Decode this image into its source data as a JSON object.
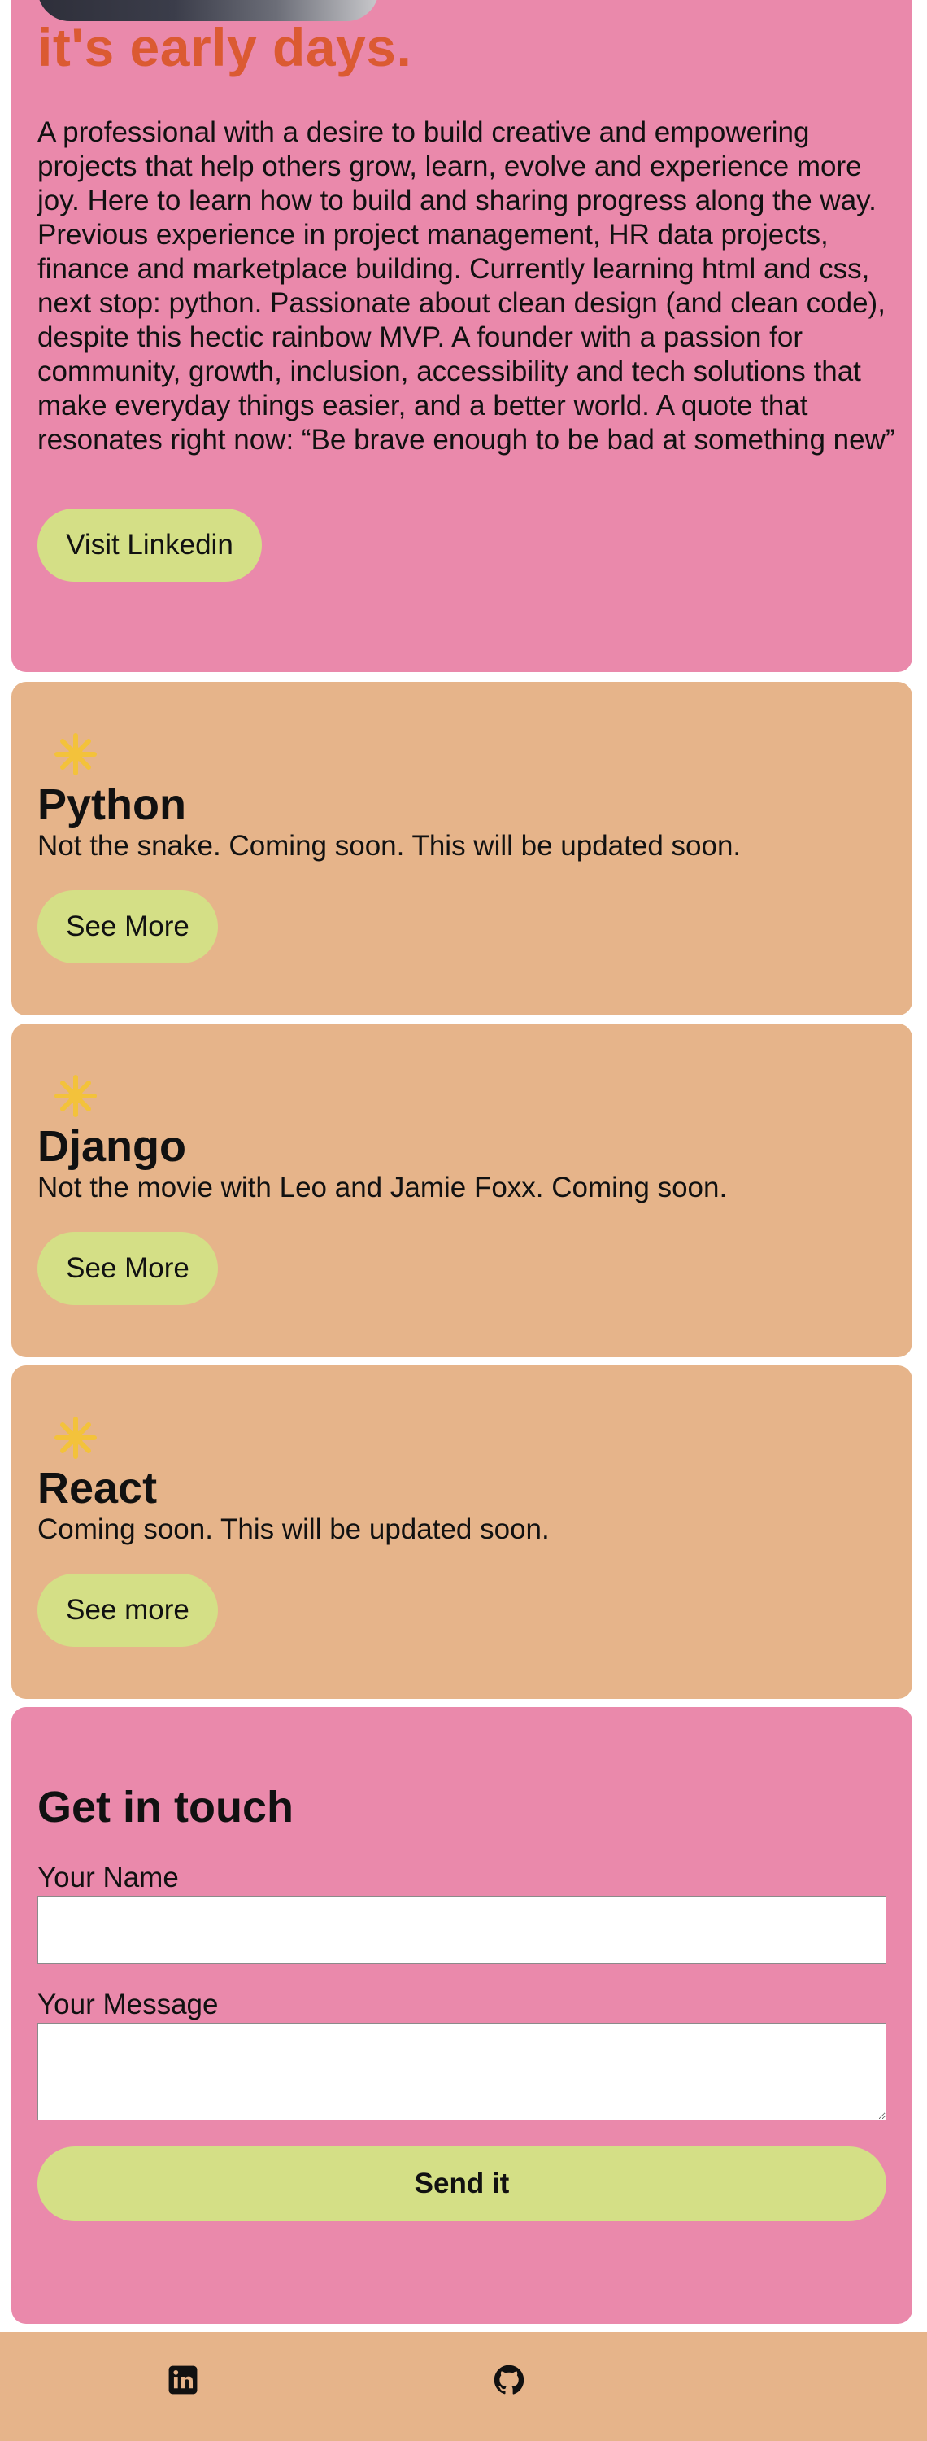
{
  "hero": {
    "title": "it's early days.",
    "bio": "A professional with a desire to build creative and empowering projects that help others grow, learn, evolve and experience more joy. Here to learn how to build and sharing progress along the way. Previous experience in project management, HR data projects, finance and marketplace building. Currently learning html and css, next stop: python. Passionate about clean design (and clean code), despite this hectic rainbow MVP. A founder with a passion for community, growth, inclusion, accessibility and tech solutions that make everyday things easier, and a better world. A quote that resonates right now: “Be brave enough to be bad at something new”",
    "button_label": "Visit Linkedin"
  },
  "skills": [
    {
      "title": "Python",
      "description": "Not the snake. Coming soon. This will be updated soon.",
      "button_label": "See More",
      "icon": "sparkle-icon"
    },
    {
      "title": "Django",
      "description": "Not the movie with Leo and Jamie Foxx. Coming soon.",
      "button_label": "See More",
      "icon": "sparkle-icon"
    },
    {
      "title": "React",
      "description": "Coming soon. This will be updated soon.",
      "button_label": "See more",
      "icon": "sparkle-icon"
    }
  ],
  "contact": {
    "heading": "Get in touch",
    "name_label": "Your Name",
    "name_value": "",
    "message_label": "Your Message",
    "message_value": "",
    "submit_label": "Send it"
  },
  "footer": {
    "icons": [
      "linkedin-icon",
      "github-icon"
    ]
  },
  "colors": {
    "pink_card": "#ea89ab",
    "tan_card": "#e6b48a",
    "title_orange": "#db5a32",
    "button_green": "#d4df86",
    "sparkle_yellow": "#f3c23b"
  }
}
